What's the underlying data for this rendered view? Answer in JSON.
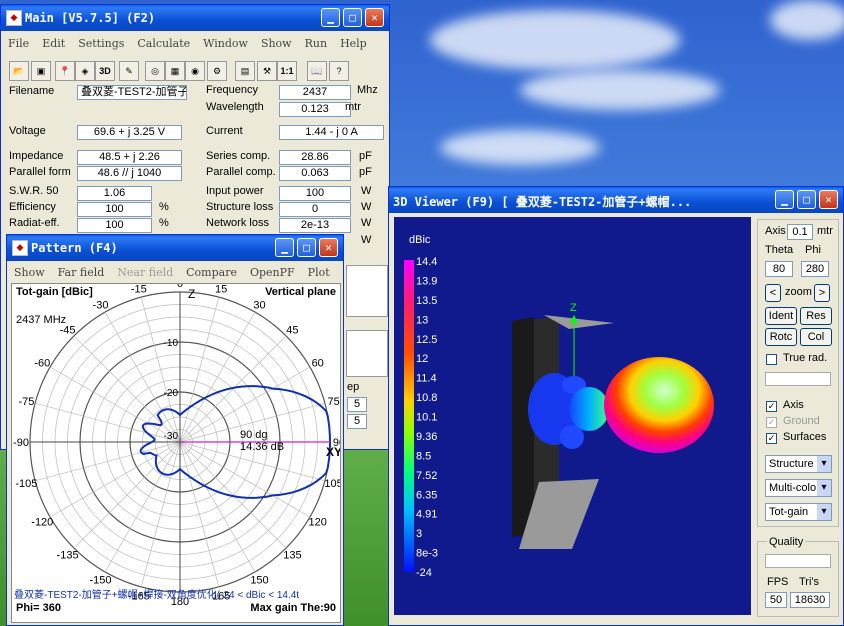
{
  "main": {
    "title": "Main [V5.7.5]   (F2)",
    "menu": [
      "File",
      "Edit",
      "Settings",
      "Calculate",
      "Window",
      "Show",
      "Run",
      "Help"
    ],
    "toolbar_icons": [
      "open-icon",
      "save-icon",
      "pin-icon",
      "cube-icon",
      "3d-icon",
      "edit-icon",
      "globe-icon",
      "grid-icon",
      "target-icon",
      "gear-icon",
      "calc-icon",
      "tool-icon",
      "scale-icon",
      "book-icon",
      "help-icon"
    ],
    "toolbar_3d": "3D",
    "toolbar_11": "1:1",
    "labels": {
      "filename": "Filename",
      "voltage": "Voltage",
      "impedance": "Impedance",
      "parallel_form": "Parallel form",
      "swr": "S.W.R. 50",
      "efficiency": "Efficiency",
      "radiat_eff": "Radiat-eff.",
      "frequency": "Frequency",
      "wavelength": "Wavelength",
      "current": "Current",
      "series_comp": "Series comp.",
      "parallel_comp": "Parallel comp.",
      "input_power": "Input power",
      "structure_loss": "Structure loss",
      "network_loss": "Network loss"
    },
    "values": {
      "filename": "叠双菱-TEST2-加管子",
      "voltage": "69.6 + j 3.25 V",
      "impedance": "48.5 + j 2.26",
      "parallel_form": "48.6 // j 1040",
      "swr": "1.06",
      "efficiency": "100",
      "radiat_eff": "100",
      "frequency": "2437",
      "wavelength": "0.123",
      "current": "1.44 - j 0 A",
      "series_comp": "28.86",
      "parallel_comp": "0.063",
      "input_power": "100",
      "structure_loss": "0",
      "network_loss": "2e-13"
    },
    "units": {
      "pct1": "%",
      "pct2": "%",
      "mhz": "Mhz",
      "mtr": "mtr",
      "pf1": "pF",
      "pf2": "pF",
      "w1": "W",
      "w2": "W",
      "w3": "W",
      "w4": "W"
    },
    "partial": {
      "ep": "ep",
      "v1": "5",
      "v2": "5"
    }
  },
  "pattern": {
    "title": "Pattern    (F4)",
    "menu": [
      {
        "label": "Show",
        "disabled": false
      },
      {
        "label": "Far field",
        "disabled": false
      },
      {
        "label": "Near field",
        "disabled": true
      },
      {
        "label": "Compare",
        "disabled": false
      },
      {
        "label": "OpenPF",
        "disabled": false
      },
      {
        "label": "Plot",
        "disabled": false
      }
    ],
    "tot_gain": "Tot-gain [dBic]",
    "plane": "Vertical plane",
    "freq": "2437 MHz",
    "z_label": "Z",
    "xy_label": "XY",
    "marker_angle": "90 dg",
    "marker_gain": "14.36 dB",
    "angle_labels": [
      "0",
      "15",
      "30",
      "45",
      "60",
      "75",
      "90",
      "105",
      "120",
      "135",
      "150",
      "165",
      "180",
      "-165",
      "-150",
      "-135",
      "-120",
      "-105",
      "-90",
      "-75",
      "-60",
      "-45",
      "-30",
      "-15"
    ],
    "ring_labels": [
      "-10",
      "-20",
      "-30"
    ],
    "footer_file": "叠双菱-TEST2-加管子+螺帽+焊接-双角度优化(-24 < dBic < 14.4t",
    "phi": "Phi= 360",
    "max_gain": "Max gain The:90",
    "accent_color": "#1030b0"
  },
  "viewer": {
    "title": "3D Viewer (F9)       [  叠双菱-TEST2-加管子+螺帽...",
    "scale_title": "dBic",
    "scale_values": [
      "14.4",
      "13.9",
      "13.5",
      "13",
      "12.5",
      "12",
      "11.4",
      "10.8",
      "10.1",
      "9.36",
      "8.5",
      "7.52",
      "6.35",
      "4.91",
      "3",
      "8e-3",
      "-24"
    ],
    "z_axis": "Z",
    "axis_label": "Axis",
    "axis_value": "0.1",
    "axis_unit": "mtr",
    "theta_label": "Theta",
    "phi_label": "Phi",
    "theta_value": "80",
    "phi_value": "280",
    "zoom_label": "zoom",
    "zoom_left": "<",
    "zoom_right": ">",
    "buttons": [
      "Ident",
      "Res",
      "Rotc",
      "Col"
    ],
    "true_rad": "True rad.",
    "checks": [
      {
        "label": "Axis",
        "checked": true,
        "disabled": false
      },
      {
        "label": "Ground",
        "checked": true,
        "disabled": true
      },
      {
        "label": "Surfaces",
        "checked": true,
        "disabled": false
      }
    ],
    "selects": [
      "Structure",
      "Multi-colo",
      "Tot-gain"
    ],
    "quality_label": "Quality",
    "fps_label": "FPS",
    "tris_label": "Tri's",
    "fps_value": "50",
    "tris_value": "18630",
    "bg_color": "#101a8c"
  }
}
